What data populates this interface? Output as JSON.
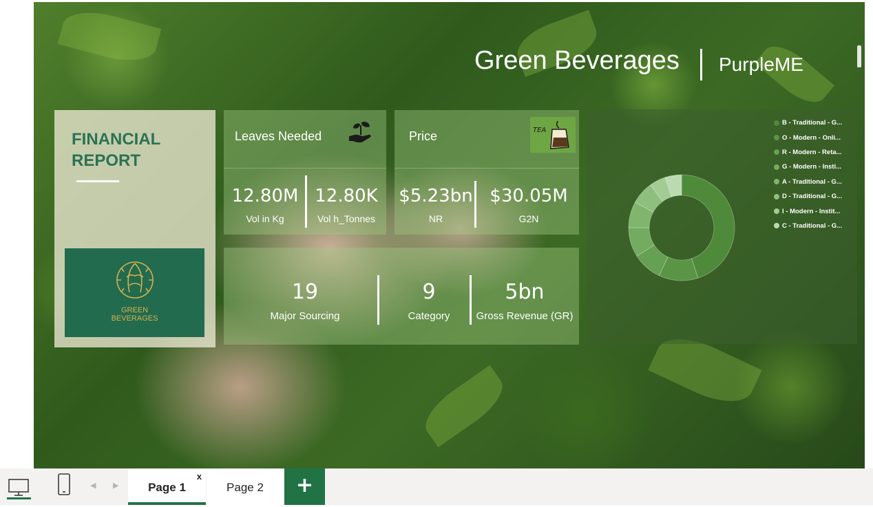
{
  "report": {
    "title": "Green Beverages",
    "subtitle": "PurpleME"
  },
  "financial_panel": {
    "title": "FINANCIAL REPORT",
    "logo_text_line1": "GREEN",
    "logo_text_line2": "BEVERAGES"
  },
  "cards": {
    "leaves": {
      "title": "Leaves Needed",
      "icon": "plant-hand-icon",
      "metrics": [
        {
          "value": "12.80M",
          "label": "Vol in Kg"
        },
        {
          "value": "12.80K",
          "label": "Vol h_Tonnes"
        }
      ]
    },
    "price": {
      "title": "Price",
      "icon": "tea-bag-icon",
      "metrics": [
        {
          "value": "$5.23bn",
          "label": "NR"
        },
        {
          "value": "$30.05M",
          "label": "G2N"
        }
      ]
    },
    "bottom_metrics": [
      {
        "value": "19",
        "label": "Major Sourcing"
      },
      {
        "value": "9",
        "label": "Category"
      },
      {
        "value": "5bn",
        "label": "Gross Revenue (GR)"
      }
    ]
  },
  "legend": [
    {
      "label": "B - Traditional - G...",
      "color": "#4e8a3a"
    },
    {
      "label": "O - Modern - Onli...",
      "color": "#5a9546"
    },
    {
      "label": "R - Modern - Reta...",
      "color": "#66a052"
    },
    {
      "label": "G - Modern - Insti...",
      "color": "#73ab60"
    },
    {
      "label": "A - Traditional - G...",
      "color": "#80b56e"
    },
    {
      "label": "D - Traditional - G...",
      "color": "#8ebf7e"
    },
    {
      "label": "I - Modern - Instit...",
      "color": "#a3cc95"
    },
    {
      "label": "C - Traditional - G...",
      "color": "#bcdab0"
    }
  ],
  "chart_data": {
    "type": "pie",
    "categories": [
      "B - Traditional - G...",
      "O - Modern - Onli...",
      "R - Modern - Reta...",
      "G - Modern - Insti...",
      "A - Traditional - G...",
      "D - Traditional - G...",
      "I - Modern - Instit...",
      "C - Traditional - G..."
    ],
    "values": [
      45,
      12,
      9,
      9,
      8,
      7,
      5,
      5
    ],
    "title": "",
    "legend": "top-right"
  },
  "tabbar": {
    "tabs": [
      "Page 1",
      "Page 2"
    ],
    "close_label": "x",
    "add_label": "+"
  }
}
